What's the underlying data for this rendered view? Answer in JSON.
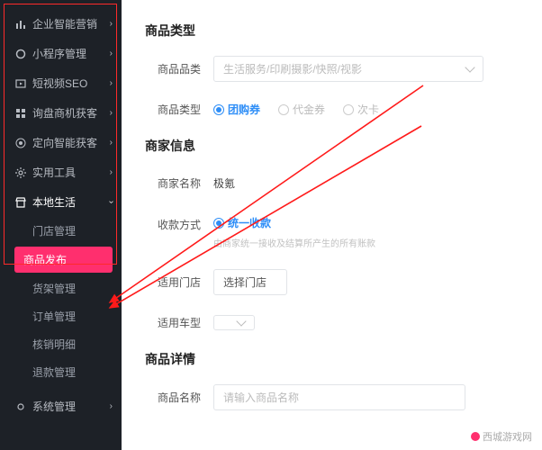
{
  "sidebar": {
    "items": [
      {
        "label": "企业智能营销"
      },
      {
        "label": "小程序管理"
      },
      {
        "label": "短视频SEO"
      },
      {
        "label": "询盘商机获客"
      },
      {
        "label": "定向智能获客"
      },
      {
        "label": "实用工具"
      },
      {
        "label": "本地生活"
      }
    ],
    "sub": [
      {
        "label": "门店管理"
      },
      {
        "label": "商品发布"
      },
      {
        "label": "货架管理"
      },
      {
        "label": "订单管理"
      },
      {
        "label": "核销明细"
      },
      {
        "label": "退款管理"
      }
    ],
    "bottom": {
      "label": "系统管理"
    }
  },
  "form": {
    "section1_title": "商品类型",
    "category_label": "商品品类",
    "category_placeholder": "生活服务/印刷摄影/快照/视影",
    "type_label": "商品类型",
    "type_options": [
      "团购券",
      "代金券",
      "次卡"
    ],
    "section2_title": "商家信息",
    "merchant_label": "商家名称",
    "merchant_value": "极氪",
    "collect_label": "收款方式",
    "collect_options": [
      "统一收款"
    ],
    "collect_hint": "由商家统一接收及结算所产生的所有账款",
    "store_label": "适用门店",
    "store_btn": "选择门店",
    "car_label": "适用车型",
    "section3_title": "商品详情",
    "name_label": "商品名称",
    "name_placeholder": "请输入商品名称"
  },
  "watermark": "西城游戏网"
}
